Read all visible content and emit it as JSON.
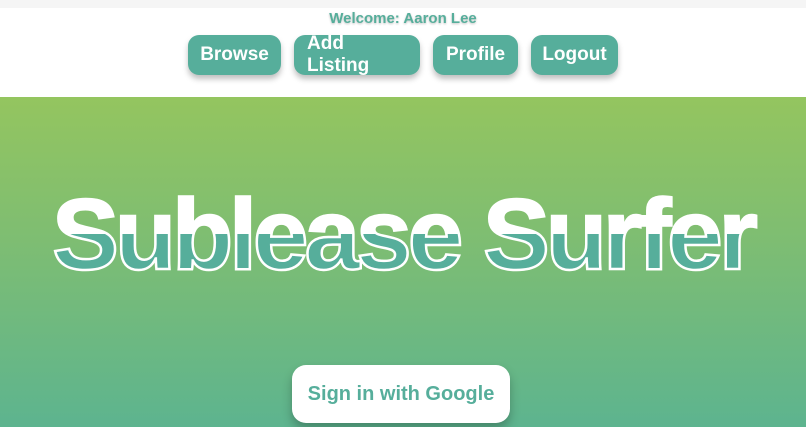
{
  "header": {
    "welcome_text": "Welcome: Aaron Lee",
    "nav": {
      "browse": "Browse",
      "add_listing": "Add Listing",
      "profile": "Profile",
      "logout": "Logout"
    }
  },
  "hero": {
    "title": "Sublease Surfer",
    "signin_label": "Sign in with Google"
  },
  "colors": {
    "accent": "#56ae9b",
    "hero_top": "#94c55f",
    "hero_bottom": "#5db48f",
    "white": "#ffffff"
  }
}
